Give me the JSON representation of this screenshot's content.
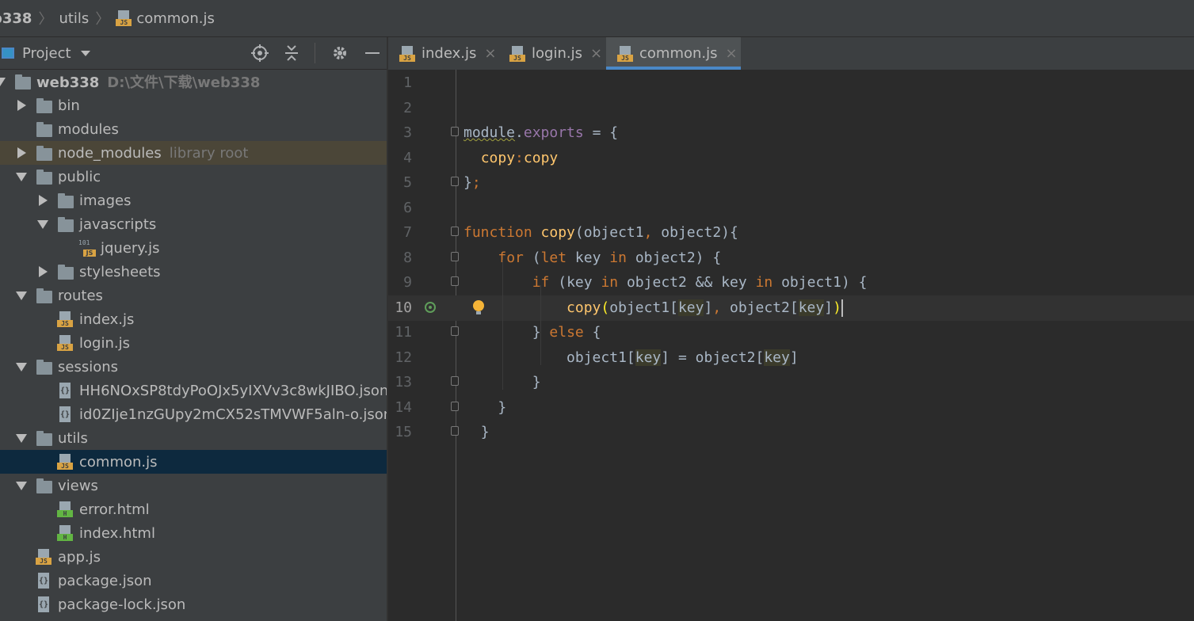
{
  "breadcrumb": {
    "items": [
      "b338",
      "utils",
      "common.js"
    ]
  },
  "project_panel": {
    "title": "Project"
  },
  "tree": [
    {
      "depth": 0,
      "type": "folder",
      "expanded": true,
      "label": "web338",
      "extra": "D:\\文件\\下载\\web338",
      "bold": true
    },
    {
      "depth": 1,
      "type": "folder",
      "expanded": false,
      "label": "bin"
    },
    {
      "depth": 1,
      "type": "folder",
      "leaf": true,
      "label": "modules"
    },
    {
      "depth": 1,
      "type": "folder",
      "expanded": false,
      "label": "node_modules",
      "extra": "library root",
      "highlight": true
    },
    {
      "depth": 1,
      "type": "folder",
      "expanded": true,
      "label": "public"
    },
    {
      "depth": 2,
      "type": "folder",
      "expanded": false,
      "label": "images"
    },
    {
      "depth": 2,
      "type": "folder",
      "expanded": true,
      "label": "javascripts"
    },
    {
      "depth": 3,
      "type": "lib",
      "label": "jquery.js"
    },
    {
      "depth": 2,
      "type": "folder",
      "expanded": false,
      "label": "stylesheets"
    },
    {
      "depth": 1,
      "type": "folder",
      "expanded": true,
      "label": "routes"
    },
    {
      "depth": 2,
      "type": "js",
      "label": "index.js"
    },
    {
      "depth": 2,
      "type": "js",
      "label": "login.js"
    },
    {
      "depth": 1,
      "type": "folder",
      "expanded": true,
      "label": "sessions"
    },
    {
      "depth": 2,
      "type": "json",
      "label": "HH6NOxSP8tdyPoOJx5yIXVv3c8wkJIBO.json"
    },
    {
      "depth": 2,
      "type": "json",
      "label": "id0ZIje1nzGUpy2mCX52sTMVWF5aln-o.json"
    },
    {
      "depth": 1,
      "type": "folder",
      "expanded": true,
      "label": "utils"
    },
    {
      "depth": 2,
      "type": "js",
      "label": "common.js",
      "selected": true
    },
    {
      "depth": 1,
      "type": "folder",
      "expanded": true,
      "label": "views"
    },
    {
      "depth": 2,
      "type": "html",
      "label": "error.html"
    },
    {
      "depth": 2,
      "type": "html",
      "label": "index.html"
    },
    {
      "depth": 1,
      "type": "js",
      "label": "app.js"
    },
    {
      "depth": 1,
      "type": "json",
      "label": "package.json"
    },
    {
      "depth": 1,
      "type": "json",
      "label": "package-lock.json"
    }
  ],
  "tabs": [
    {
      "label": "index.js",
      "active": false
    },
    {
      "label": "login.js",
      "active": false
    },
    {
      "label": "common.js",
      "active": true
    }
  ],
  "tab_close_glyph": "×",
  "editor": {
    "current_line": 10,
    "line_numbers": [
      "1",
      "2",
      "3",
      "4",
      "5",
      "6",
      "7",
      "8",
      "9",
      "10",
      "11",
      "12",
      "13",
      "14",
      "15"
    ],
    "lines": [
      "",
      "",
      "module.exports = {",
      "  copy:copy",
      "};",
      "",
      "function copy(object1, object2){",
      "    for (let key in object2) {",
      "        if (key in object2 && key in object1) {",
      "            copy(object1[key], object2[key])",
      "        } else {",
      "            object1[key] = object2[key]",
      "        }",
      "    }",
      "  }"
    ]
  },
  "icons": {
    "file_js_label": "JS",
    "file_html_label": "H",
    "file_json_label": "{}",
    "file_lib_label": "101"
  },
  "colors": {
    "keyword": "#cc7832",
    "function": "#ffc66d",
    "identifier": "#a9b7c6",
    "property": "#9876aa",
    "selection": "#0d293e",
    "active_tab_underline": "#4a88c7"
  }
}
